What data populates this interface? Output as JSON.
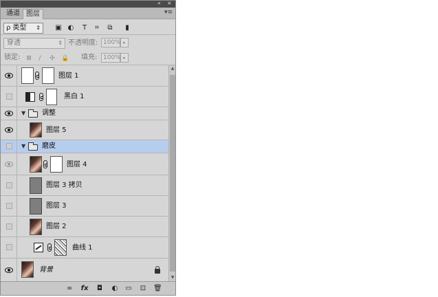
{
  "tabs": [
    "通道",
    "图层"
  ],
  "window_controls": [
    "«",
    "×"
  ],
  "tab_menu_icon": "panel-menu-icon",
  "filter": {
    "kind_label": "ρ 类型",
    "icons": [
      "image-filter-icon",
      "adjustment-filter-icon",
      "text-filter-icon",
      "shape-filter-icon",
      "smart-object-filter-icon",
      "filter-toggle-icon"
    ],
    "icon_glyphs": [
      "▣",
      "◐",
      "T",
      "⌗",
      "⧉",
      "▮"
    ]
  },
  "blend": {
    "mode": "穿透",
    "opacity_label": "不透明度:",
    "opacity_value": "100%"
  },
  "lock": {
    "label": "锁定:",
    "icons": [
      "lock-pixels-icon",
      "lock-paint-icon",
      "lock-move-icon",
      "lock-all-icon"
    ],
    "icon_glyphs": [
      "⊠",
      "∕",
      "✣",
      "🔒"
    ],
    "fill_label": "填充:",
    "fill_value": "100%"
  },
  "layers": [
    {
      "name": "图层 1",
      "visible": true,
      "type": "masked"
    },
    {
      "name": "黑白 1",
      "visible": false,
      "type": "adjustment"
    },
    {
      "name": "调整",
      "visible": true,
      "type": "group"
    },
    {
      "name": "图层 5",
      "visible": true,
      "type": "photo"
    },
    {
      "name": "磨皮",
      "visible": false,
      "type": "group",
      "selected": true
    },
    {
      "name": "图层 4",
      "visible": true,
      "dim": true,
      "type": "photo-masked"
    },
    {
      "name": "图层 3 拷贝",
      "visible": false,
      "type": "gray"
    },
    {
      "name": "图层 3",
      "visible": false,
      "type": "gray"
    },
    {
      "name": "图层 2",
      "visible": false,
      "type": "photo"
    },
    {
      "name": "曲线 1",
      "visible": false,
      "type": "curves"
    },
    {
      "name": "背景",
      "visible": true,
      "type": "background",
      "locked": true
    }
  ],
  "bottom_icons": [
    "link-layers-icon",
    "fx-icon",
    "add-mask-icon",
    "new-adjustment-icon",
    "new-group-icon",
    "new-layer-icon",
    "delete-icon"
  ],
  "bottom_glyphs": [
    "∞",
    "fx",
    "◘",
    "◐",
    "▭",
    "⊡",
    "🗑"
  ]
}
